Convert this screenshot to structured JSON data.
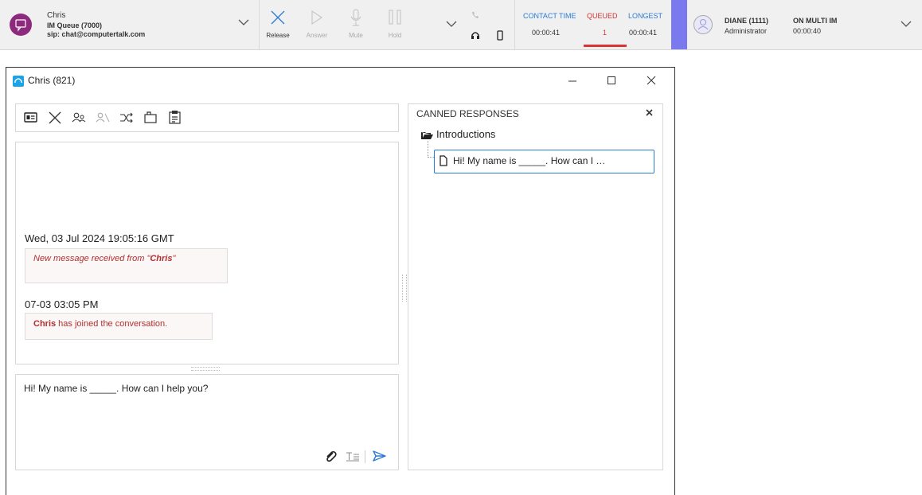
{
  "topbar": {
    "caller": {
      "name": "Chris",
      "queue": "IM Queue (7000)",
      "sip": "sip: chat@computertalk.com"
    },
    "controls": [
      {
        "label": "Release",
        "icon": "close-icon",
        "enabled": true
      },
      {
        "label": "Answer",
        "icon": "play-icon",
        "enabled": false
      },
      {
        "label": "Mute",
        "icon": "microphone-icon",
        "enabled": false
      },
      {
        "label": "Hold",
        "icon": "pause-icon",
        "enabled": false
      }
    ],
    "stats": [
      {
        "label": "CONTACT TIME",
        "value": "00:00:41",
        "color": "#2b7bd6"
      },
      {
        "label": "QUEUED",
        "value": "1",
        "color": "#d33333"
      },
      {
        "label": "LONGEST",
        "value": "00:00:41",
        "color": "#2b7bd6"
      }
    ],
    "agent": {
      "name": "DIANE (1111)",
      "role": "Administrator",
      "state": "ON MULTI IM",
      "state_time": "00:00:40"
    }
  },
  "window": {
    "title": "Chris (821)",
    "toolbar_icons": [
      "contact-card-icon",
      "close-icon",
      "transfer-agent-icon",
      "conference-icon",
      "redirect-icon",
      "folder-icon",
      "transcript-icon"
    ],
    "conversation": {
      "date": "Wed, 03 Jul 2024 19:05:16 GMT",
      "system_message_prefix": "New message received from \"",
      "system_message_name": "Chris",
      "system_message_suffix": "\"",
      "time": "07-03 03:05 PM",
      "join_name": "Chris",
      "join_text": " has joined the conversation."
    },
    "compose": {
      "text": "Hi! My name is _____. How can I help you?"
    },
    "canned": {
      "title": "CANNED RESPONSES",
      "folder": "Introductions",
      "item": "Hi! My name is _____. How can I …"
    }
  },
  "colors": {
    "accent_blue": "#2b7bd6",
    "queued_red": "#d33333",
    "agent_strip": "#7a7aee",
    "chat_avatar": "#8e2a7e",
    "message_red": "#b03030"
  }
}
